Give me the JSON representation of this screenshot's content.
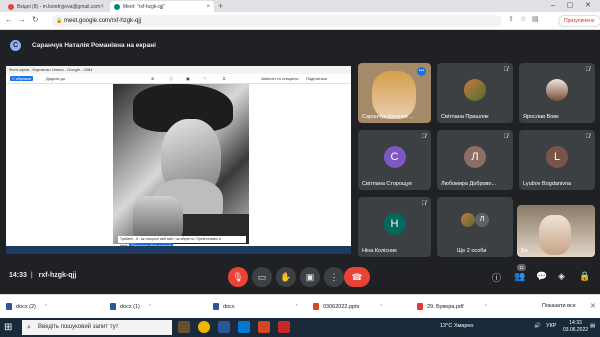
{
  "browser": {
    "tabs": [
      {
        "label": "Вхідні (8) - m.kondryjeva@gmail.com",
        "fav": "#ea4335"
      },
      {
        "label": "Meet: \"rxf-hzgk-qjj\"",
        "fav": "#00897b"
      }
    ],
    "new_tab": "+",
    "url": "meet.google.com/rxf-hzgk-qjj",
    "pause_label": "Призупинено"
  },
  "meet": {
    "presenter_initial": "С",
    "presenter_text": "Саранчук Наталія Романівна на екрані",
    "presentation": {
      "title": "Фото-архів - Корнієнко Олеся - Google - 2084",
      "tool_left": "У збірники",
      "tool_mid": "Додати до",
      "tool_right1": "Змінити та створити",
      "tool_right2": "Поділитися",
      "note": "Тумбаніт - 8 - як створити свій сайт / як зберегти / Презентовано в Meet",
      "note_btn": "Припинити обмін екраном"
    },
    "tiles": [
      {
        "name": "Саранчук Наталія ...",
        "kind": "photo",
        "color": "#a58a6a"
      },
      {
        "name": "Світлана Пришляк",
        "kind": "photo",
        "color": "#7c6b5a"
      },
      {
        "name": "Ярослав Вовк",
        "kind": "photo",
        "color": "#c9b9a8"
      },
      {
        "name": "Світлана Сторощук",
        "kind": "letter",
        "letter": "С",
        "color": "#7e57c2"
      },
      {
        "name": "Любомира Доброво...",
        "kind": "letter",
        "letter": "Л",
        "color": "#8d6e63"
      },
      {
        "name": "Lyubov Bogdanivna",
        "kind": "letter",
        "letter": "L",
        "color": "#795548"
      },
      {
        "name": "Ніна Колісник",
        "kind": "letter",
        "letter": "Н",
        "color": "#00695c"
      },
      {
        "name": "Ще 2 особи",
        "kind": "more",
        "letter": "Л",
        "color": "#5f6368"
      },
      {
        "name": "Ви",
        "kind": "self",
        "color": "#c5b7a3"
      }
    ],
    "time": "14:33",
    "code": "rxf-hzgk-qjj",
    "participants_count": "11"
  },
  "downloads": {
    "items": [
      {
        "label": "docx (2)",
        "color": "#2b579a"
      },
      {
        "label": "docx (1)",
        "color": "#2b579a"
      },
      {
        "label": "docx",
        "color": "#2b579a"
      },
      {
        "label": "03062022.pptx",
        "color": "#d24726"
      },
      {
        "label": "29. Бувера.pdf",
        "color": "#e53935"
      }
    ],
    "show_all": "Показати все"
  },
  "taskbar": {
    "search_placeholder": "Введіть пошуковий запит тут",
    "temp": "13°C Хмарно",
    "lang": "УКР",
    "time": "14:33",
    "date": "03.06.2022"
  }
}
